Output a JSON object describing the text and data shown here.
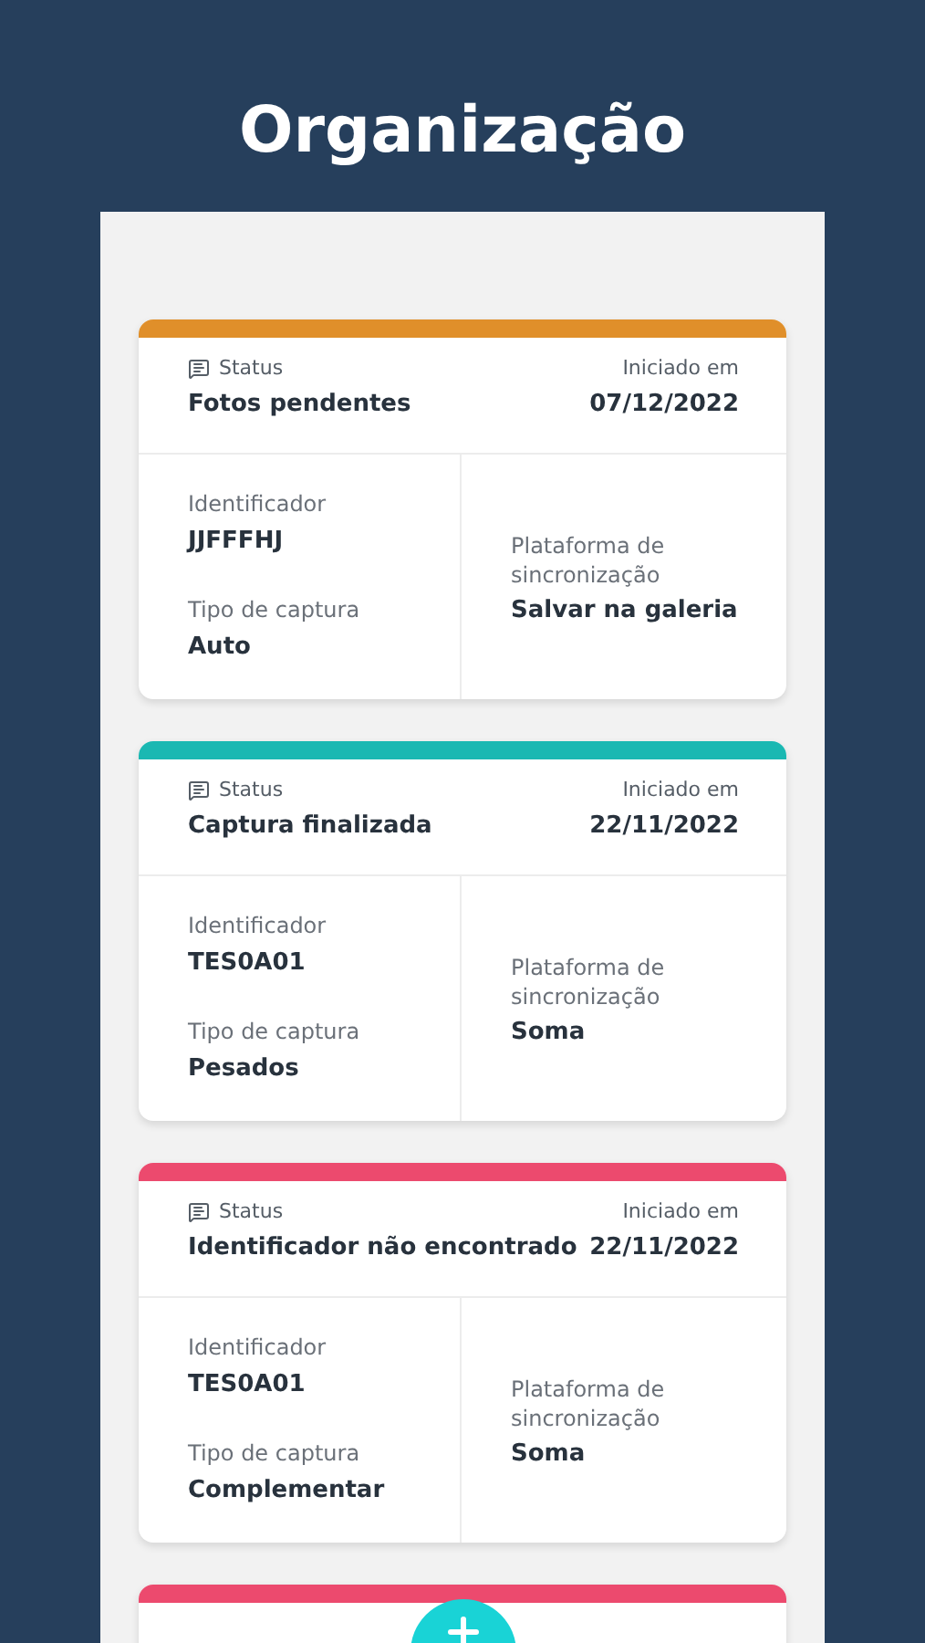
{
  "heading": "Organização",
  "cards": [
    {
      "color": "#e08f2a",
      "status_label": "Status",
      "status": "Fotos pendentes",
      "started_label": "Iniciado em",
      "started": "07/12/2022",
      "id_label": "Identificador",
      "id": "JJFFFHJ",
      "capture_label": "Tipo de captura",
      "capture": "Auto",
      "platform_label": "Plataforma de sincronização",
      "platform": "Salvar na galeria"
    },
    {
      "color": "#1ab8b2",
      "status_label": "Status",
      "status": "Captura finalizada",
      "started_label": "Iniciado em",
      "started": "22/11/2022",
      "id_label": "Identificador",
      "id": "TES0A01",
      "capture_label": "Tipo de captura",
      "capture": "Pesados",
      "platform_label": "Plataforma de sincronização",
      "platform": "Soma"
    },
    {
      "color": "#ec4a6e",
      "status_label": "Status",
      "status": "Identificador não encontrado",
      "started_label": "Iniciado em",
      "started": "22/11/2022",
      "id_label": "Identificador",
      "id": "TES0A01",
      "capture_label": "Tipo de captura",
      "capture": "Complementar",
      "platform_label": "Plataforma de sincronização",
      "platform": "Soma"
    },
    {
      "color": "#ec4a6e"
    }
  ]
}
